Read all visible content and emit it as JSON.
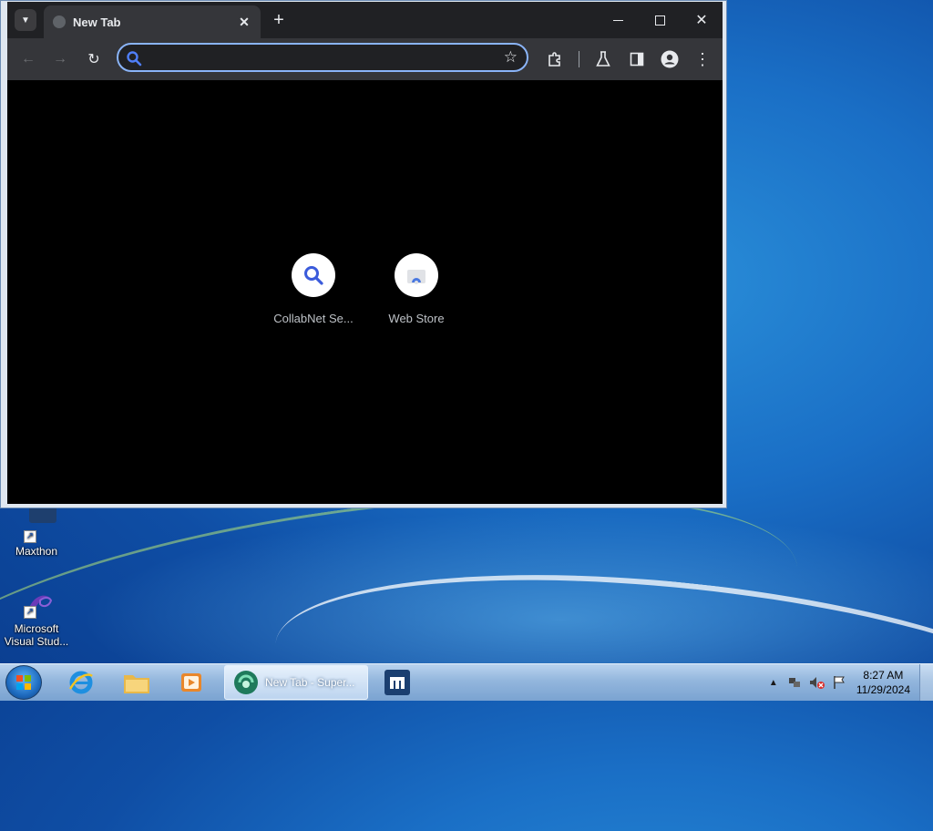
{
  "desktop": {
    "icons": [
      {
        "label": "Maxthon"
      },
      {
        "label": "Microsoft Visual Stud..."
      }
    ]
  },
  "browser": {
    "tab": {
      "title": "New Tab"
    },
    "omnibox": {
      "value": "",
      "placeholder": ""
    },
    "tiles": [
      {
        "label": "CollabNet Se...",
        "icon": "search-icon"
      },
      {
        "label": "Web Store",
        "icon": "web-store-icon"
      }
    ]
  },
  "taskbar": {
    "active_window": "New Tab - Super...",
    "time": "8:27 AM",
    "date": "11/29/2024"
  }
}
